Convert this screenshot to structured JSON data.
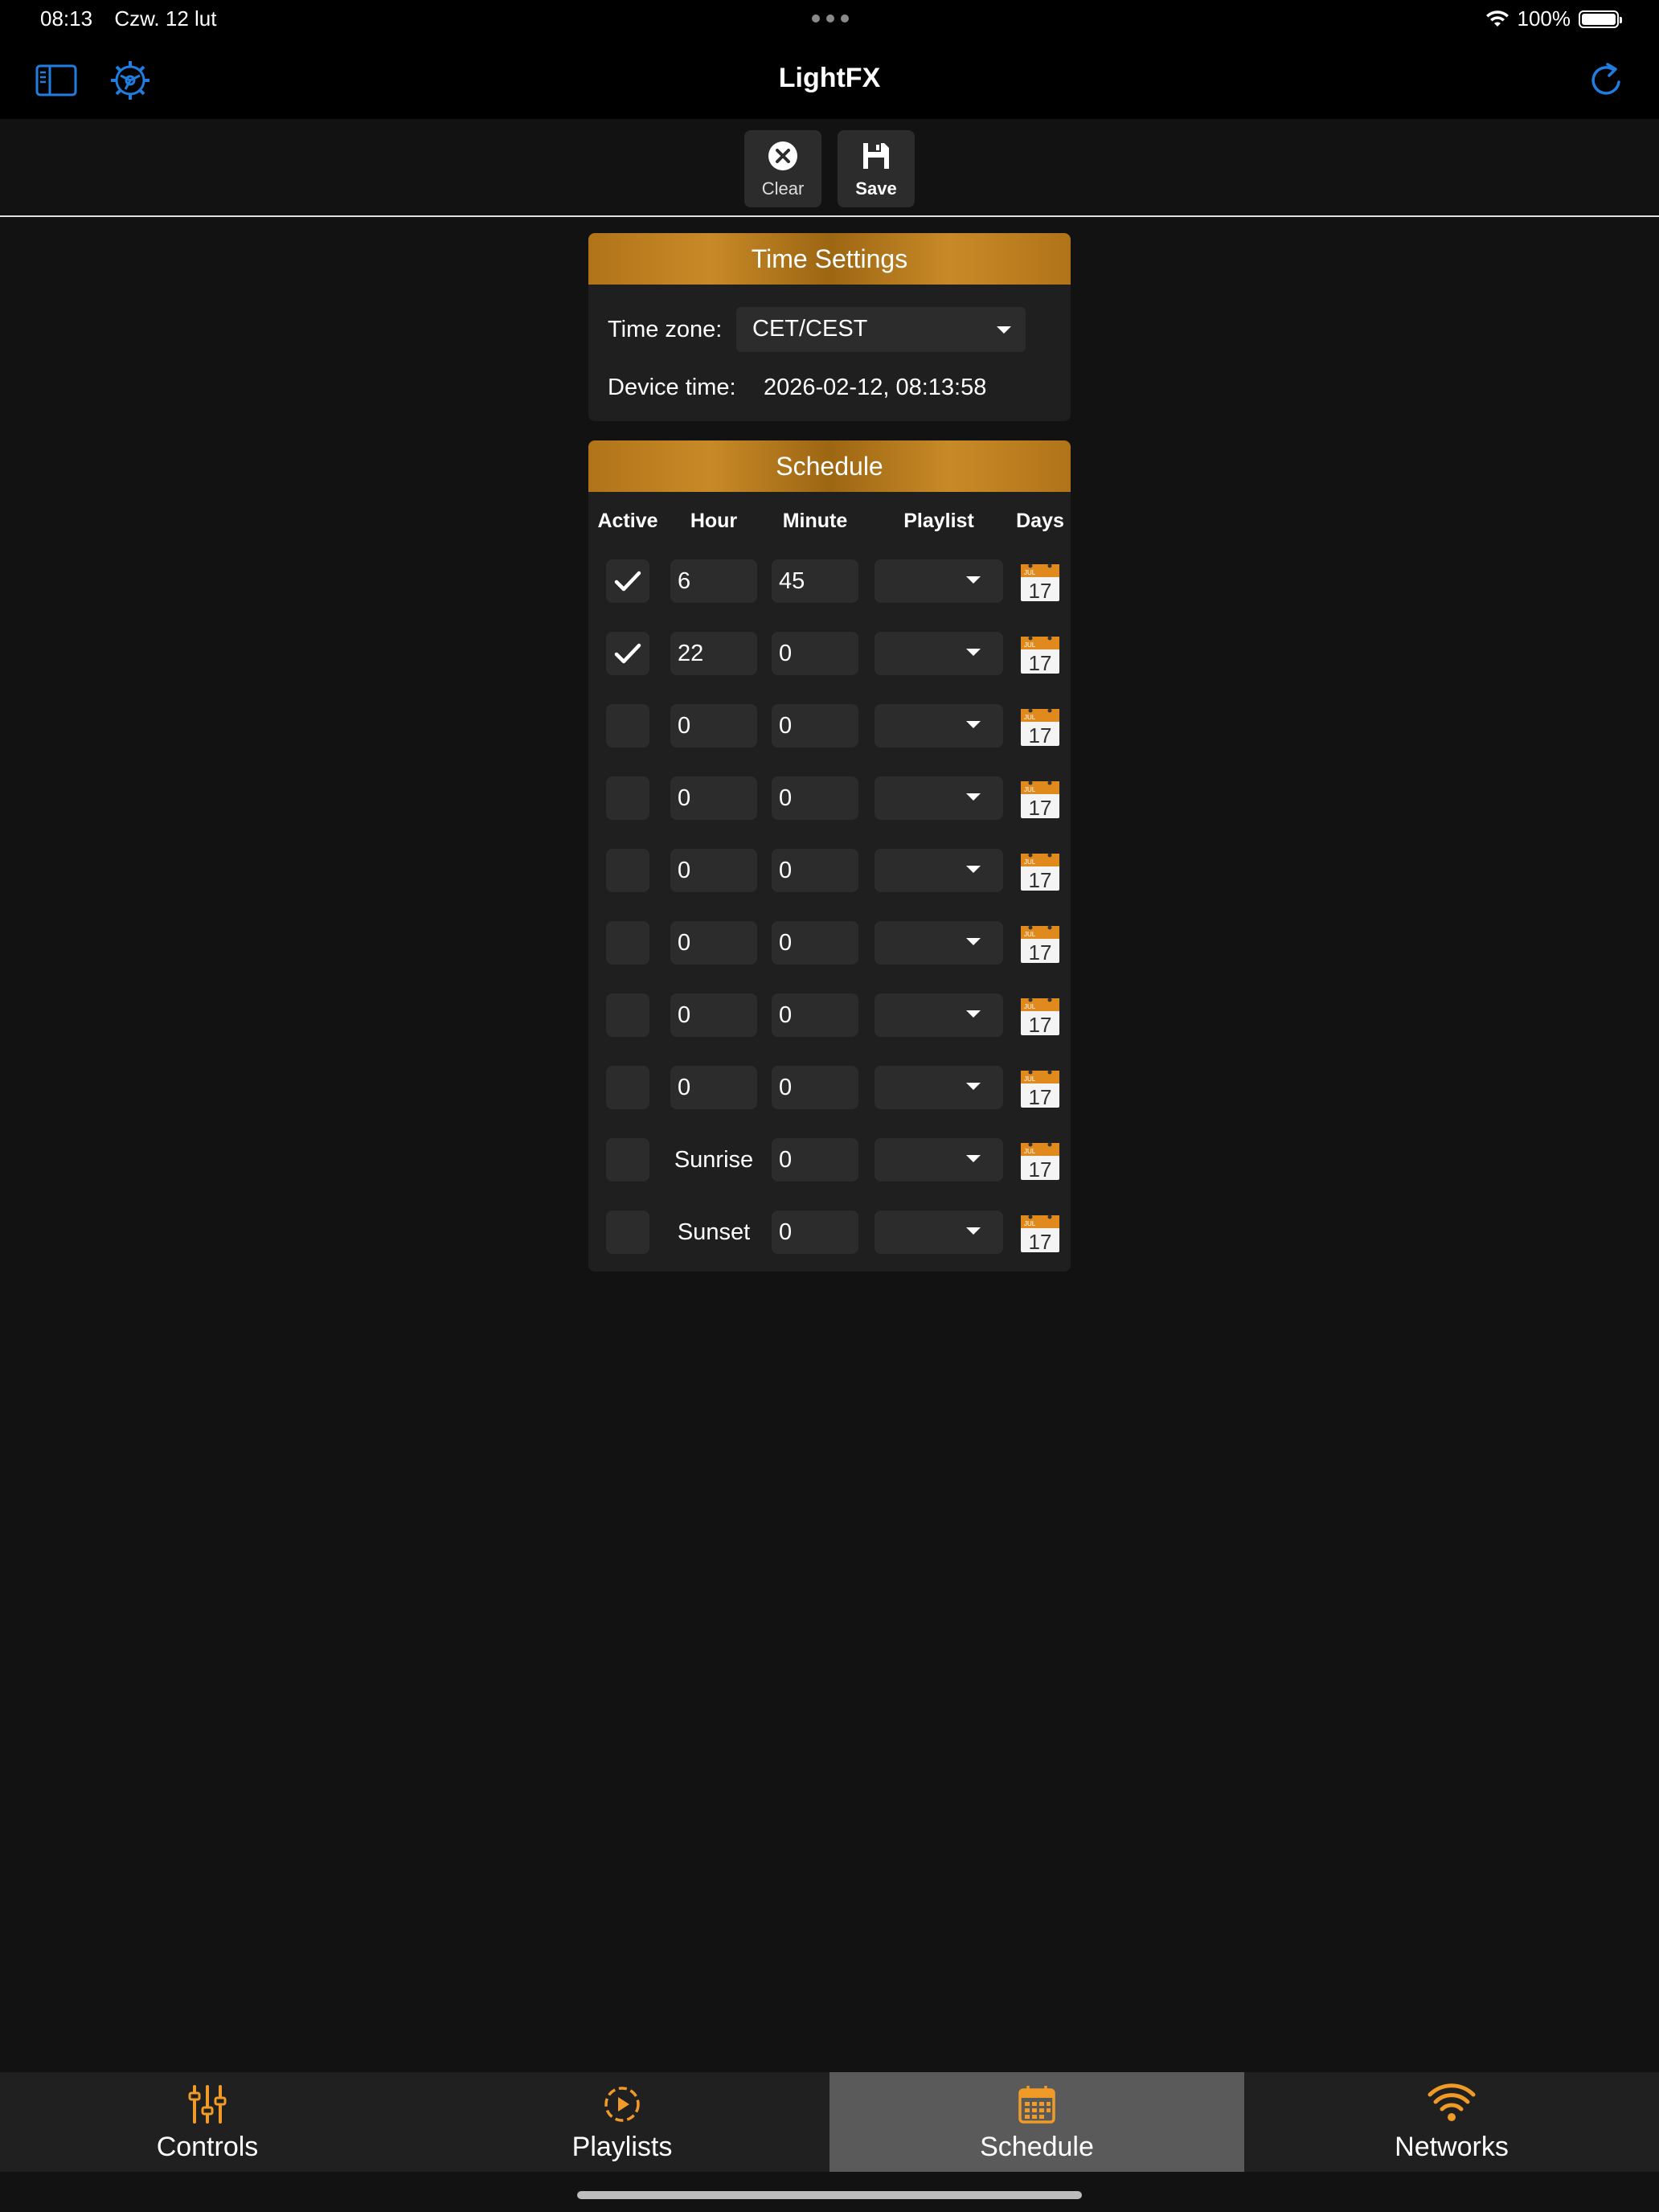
{
  "status": {
    "time": "08:13",
    "date": "Czw. 12 lut",
    "battery": "100%"
  },
  "nav": {
    "title": "LightFX"
  },
  "toolbar": {
    "clear_label": "Clear",
    "save_label": "Save"
  },
  "time_settings": {
    "header": "Time Settings",
    "timezone_label": "Time zone:",
    "timezone_value": "CET/CEST",
    "device_time_label": "Device time:",
    "device_time_value": "2026-02-12, 08:13:58"
  },
  "schedule": {
    "header": "Schedule",
    "columns": [
      "Active",
      "Hour",
      "Minute",
      "Playlist",
      "Days"
    ],
    "rows": [
      {
        "active": true,
        "hour": "6",
        "minute": "45",
        "playlist": ""
      },
      {
        "active": true,
        "hour": "22",
        "minute": "0",
        "playlist": ""
      },
      {
        "active": false,
        "hour": "0",
        "minute": "0",
        "playlist": ""
      },
      {
        "active": false,
        "hour": "0",
        "minute": "0",
        "playlist": ""
      },
      {
        "active": false,
        "hour": "0",
        "minute": "0",
        "playlist": ""
      },
      {
        "active": false,
        "hour": "0",
        "minute": "0",
        "playlist": ""
      },
      {
        "active": false,
        "hour": "0",
        "minute": "0",
        "playlist": ""
      },
      {
        "active": false,
        "hour": "0",
        "minute": "0",
        "playlist": ""
      },
      {
        "active": false,
        "hour": "Sunrise",
        "minute": "0",
        "playlist": "",
        "hour_fixed": true
      },
      {
        "active": false,
        "hour": "Sunset",
        "minute": "0",
        "playlist": "",
        "hour_fixed": true
      }
    ],
    "calendar_icon": {
      "month": "JUL",
      "day": "17"
    }
  },
  "tabs": [
    {
      "label": "Controls",
      "icon": "sliders-icon",
      "active": false
    },
    {
      "label": "Playlists",
      "icon": "play-circle-icon",
      "active": false
    },
    {
      "label": "Schedule",
      "icon": "calendar-icon",
      "active": true
    },
    {
      "label": "Networks",
      "icon": "wifi-icon",
      "active": false
    }
  ],
  "colors": {
    "accent_blue": "#1f7ee0",
    "accent_orange": "#f09a27",
    "header_gold": "#b87a1c"
  }
}
